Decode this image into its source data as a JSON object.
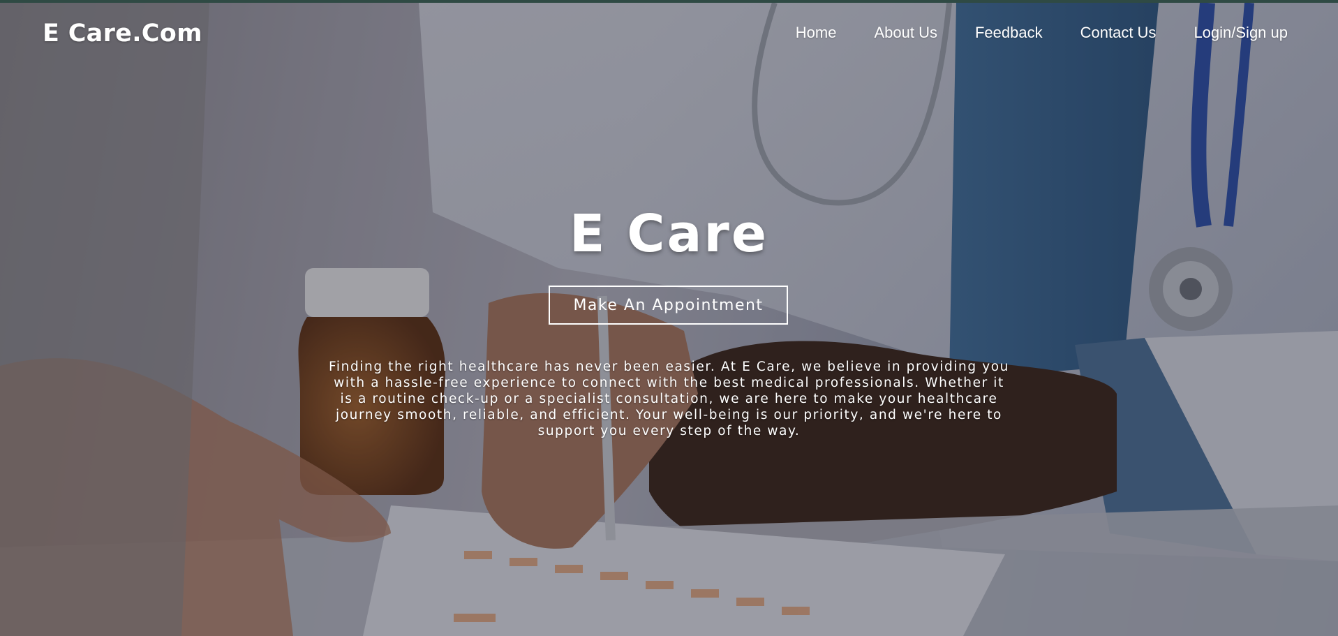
{
  "brand": {
    "name": "E Care.Com"
  },
  "nav": {
    "items": [
      {
        "label": "Home"
      },
      {
        "label": "About Us"
      },
      {
        "label": "Feedback"
      },
      {
        "label": "Contact Us"
      },
      {
        "label": "Login/Sign up"
      }
    ]
  },
  "hero": {
    "title": "E Care",
    "cta_label": "Make An Appointment",
    "description": "Finding the right healthcare has never been easier. At E Care, we believe in providing you with a hassle-free experience to connect with the best medical professionals. Whether it is a routine check-up or a specialist consultation, we are here to make your healthcare journey smooth, reliable, and efficient. Your well-being is our priority, and we're here to support you every step of the way."
  },
  "colors": {
    "text": "#ffffff",
    "top_border": "#2f4a44",
    "overlay": "rgba(30,30,40,0.35)"
  }
}
